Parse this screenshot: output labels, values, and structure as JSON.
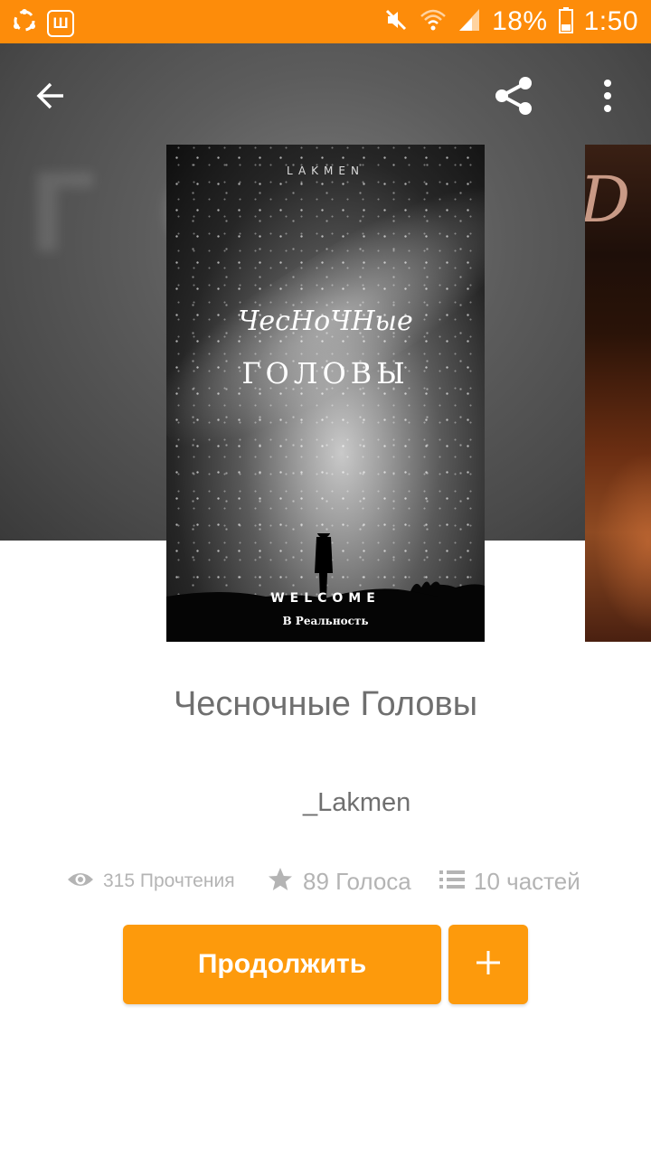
{
  "status_bar": {
    "battery": "18%",
    "time": "1:50",
    "app_icon_letter": "Ш"
  },
  "toolbar": {
    "back_icon": "arrow-left-icon",
    "share_icon": "share-icon",
    "more_icon": "more-vertical-icon"
  },
  "cover": {
    "author": "LAKMEN",
    "title_line1": "ЧесНоЧНые",
    "title_line2": "ГОЛОВЫ",
    "welcome": "WELCOME",
    "subtitle": "В Реальность"
  },
  "story": {
    "title": "Чесночные Головы",
    "author": "_Lakmen"
  },
  "stats": {
    "reads": "315 Прочтения",
    "votes": "89 Голоса",
    "parts": "10 частей"
  },
  "actions": {
    "continue_label": "Продолжить",
    "add_label": "+"
  },
  "colors": {
    "accent": "#fd9a0c",
    "status_bar": "#fd8c0a",
    "text_primary": "#6f6f6f",
    "text_secondary": "#b4b4b4"
  }
}
